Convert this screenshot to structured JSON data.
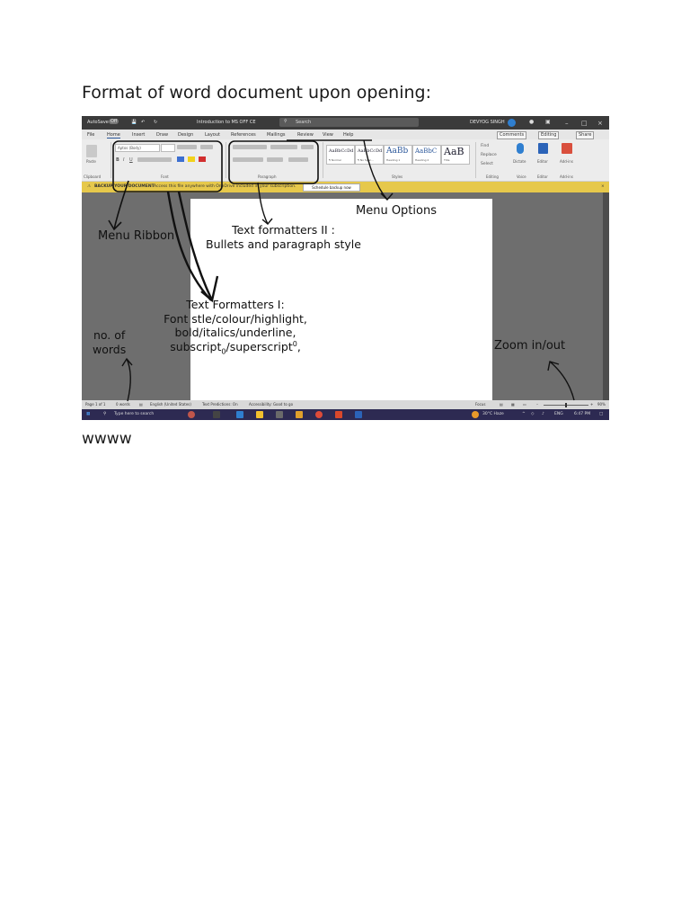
{
  "document": {
    "heading": "Format of word document upon opening:",
    "footer_text": "wwww"
  },
  "screenshot": {
    "titlebar": {
      "autosave": "AutoSave",
      "toggle": "Off",
      "doc_title": "Introduction to MS OFF CE",
      "search": "Search",
      "user": "DEVYOG SINGH"
    },
    "tabs": [
      "File",
      "Home",
      "Insert",
      "Draw",
      "Design",
      "Layout",
      "References",
      "Mailings",
      "Review",
      "View",
      "Help"
    ],
    "tab_actions": {
      "comments": "Comments",
      "editing": "Editing",
      "share": "Share"
    },
    "ribbon": {
      "paste": "Paste",
      "font_name": "Aptos (Body)",
      "groups": {
        "clipboard": "Clipboard",
        "font": "Font",
        "paragraph": "Paragraph",
        "styles": "Styles",
        "editing": "Editing",
        "voice": "Voice",
        "editor": "Editor",
        "addins": "Add-ins"
      },
      "styles": [
        {
          "sample": "AaBbCcDd",
          "name": "¶ Normal"
        },
        {
          "sample": "AaBbCcDd",
          "name": "¶ No Spac..."
        },
        {
          "sample": "AaBb",
          "name": "Heading 1"
        },
        {
          "sample": "AaBbC",
          "name": "Heading 2"
        },
        {
          "sample": "AaB",
          "name": "Title"
        }
      ],
      "editing_items": [
        "Find",
        "Replace",
        "Select"
      ],
      "voice": "Dictate",
      "editor": "Editor",
      "addins": "Add-ins"
    },
    "infobar": {
      "title": "BACKUP YOUR DOCUMENT",
      "message": "Access this file anywhere with OneDrive included in your subscription.",
      "button": "Schedule backup now"
    },
    "statusbar": {
      "page": "Page 1 of 1",
      "words": "0 words",
      "language": "English (United States)",
      "predictions": "Text Predictions: On",
      "accessibility": "Accessibility: Good to go",
      "focus": "Focus",
      "zoom": "90%"
    },
    "taskbar": {
      "search": "Type here to search",
      "weather": "30°C Haze",
      "lang": "ENG",
      "time": "6:47 PM"
    }
  },
  "annotations": {
    "menu_options": "Menu Options",
    "menu_ribbon": "Menu Ribbon",
    "text_formatters_2": [
      "Text formatters II :",
      "Bullets and paragraph style"
    ],
    "text_formatters_1_title": "Text Formatters I:",
    "text_formatters_1_line1": "Font stle/colour/highlight,",
    "text_formatters_1_line2": "bold/italics/underline,",
    "text_formatters_1_line3_pre": "subscript",
    "text_formatters_1_line3_sub": "0",
    "text_formatters_1_line3_mid": "/superscript",
    "text_formatters_1_line3_sup": "0",
    "text_formatters_1_line3_post": ",",
    "no_of_words": [
      "no. of",
      "words"
    ],
    "zoom": "Zoom in/out"
  }
}
